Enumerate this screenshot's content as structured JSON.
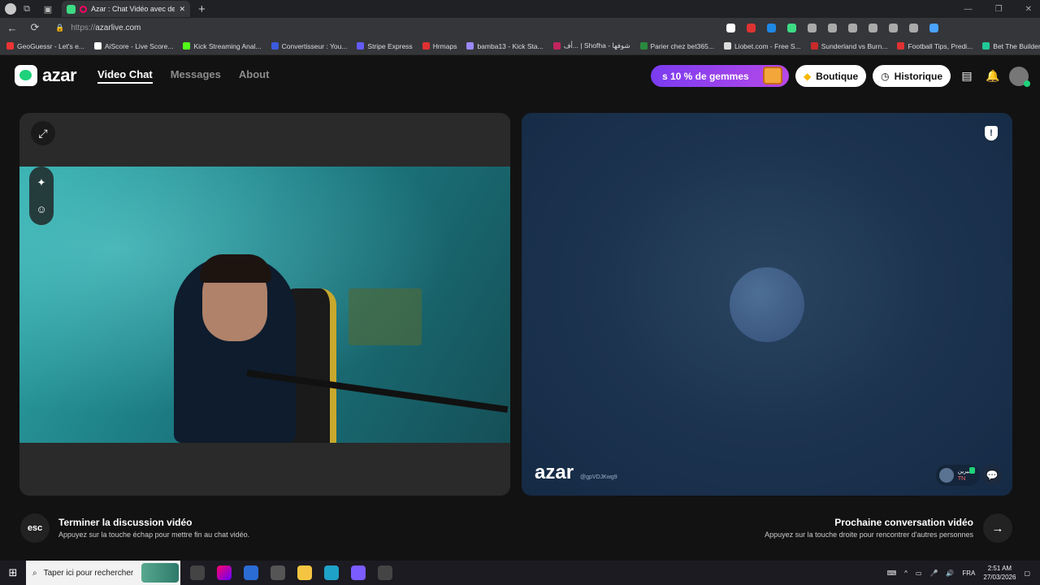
{
  "browser": {
    "tab_title": "Azar : Chat Vidéo avec de n",
    "url_scheme": "https://",
    "url_host": "azarlive.com",
    "bookmarks": [
      "GeoGuessr - Let's e...",
      "AiScore - Live Score...",
      "Kick Streaming Anal...",
      "Convertisseur : You...",
      "Stripe Express",
      "Hrmaps",
      "bamba13 - Kick Sta...",
      "أف... | Shofha - شوفها",
      "Parier chez bet365...",
      "Liobet.com - Free S...",
      "Sunderland vs Burn...",
      "Football Tips, Predi...",
      "Bet The Builder"
    ]
  },
  "header": {
    "logo_text": "azar",
    "nav": [
      "Video Chat",
      "Messages",
      "About"
    ],
    "promo_text": "s 10 % de gemmes",
    "boutique_label": "Boutique",
    "history_label": "Historique"
  },
  "remote": {
    "watermark": "azar",
    "user_id": "@gpVDJKwg9",
    "peer_name": "سيرين",
    "peer_country": "TN"
  },
  "bottom": {
    "esc_label": "esc",
    "end_title": "Terminer la discussion vidéo",
    "end_subtitle": "Appuyez sur la touche échap pour mettre fin au chat vidéo.",
    "next_title": "Prochaine conversation vidéo",
    "next_subtitle": "Appuyez sur la touche droite pour rencontrer d'autres personnes"
  },
  "taskbar": {
    "search_placeholder": "Taper ici pour rechercher",
    "language": "FRA",
    "time": "2:51 AM",
    "date": "27/03/2026"
  },
  "colors": {
    "brand_green": "#1fd17a",
    "promo_purple": "#7b3cf0",
    "app_bg": "#121212"
  }
}
